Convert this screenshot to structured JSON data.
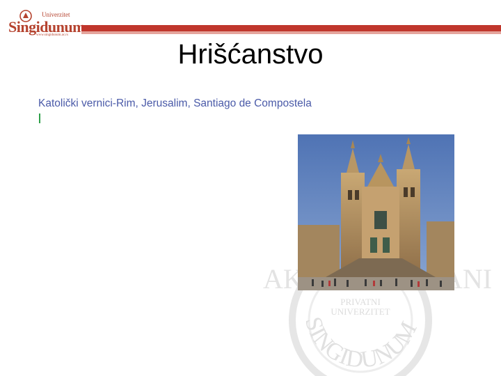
{
  "logo": {
    "top_text": "Univerzitet",
    "name": "Singidunum",
    "url": "www.singidunum.ac.rs"
  },
  "slide": {
    "title": "Hrišćanstvo",
    "subtitle": "Katolički vernici-Rim, Jerusalim, Santiago de Compostela"
  },
  "watermark": {
    "line1": "PRIVATNI",
    "line2": "UNIVERZITET",
    "arc": "SINGIDUNUM",
    "top_left": "AK",
    "top_right": "ANI"
  },
  "colors": {
    "brand_red": "#c0362c",
    "subtitle_blue": "#4a5aa8",
    "bullet_green": "#2fa04a"
  }
}
